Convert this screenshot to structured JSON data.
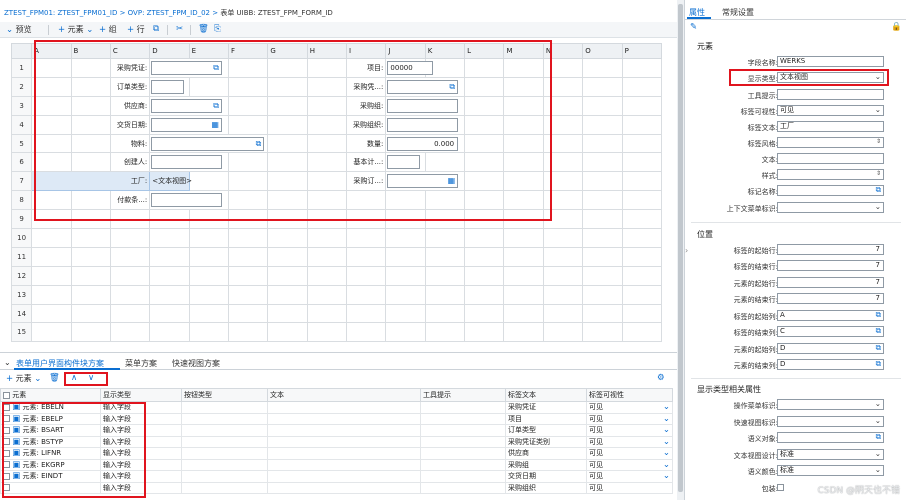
{
  "breadcrumb": {
    "path": "ZTEST_FPM01: ZTEST_FPM01_ID > OVP: ZTEST_FPM_ID_02 > ",
    "current": "表单 UIBB: ZTEST_FPM_FORM_ID"
  },
  "toolbar": {
    "preview": "预览",
    "add_element": "元素",
    "add_group": "组",
    "add_row": "行"
  },
  "grid": {
    "columns": [
      "A",
      "B",
      "C",
      "D",
      "E",
      "F",
      "G",
      "H",
      "I",
      "J",
      "K",
      "L",
      "M",
      "N",
      "O",
      "P"
    ],
    "rows": [
      "1",
      "2",
      "3",
      "4",
      "5",
      "6",
      "7",
      "8",
      "9",
      "10",
      "11",
      "12",
      "13",
      "14",
      "15"
    ],
    "labels": {
      "c1": "采购凭证:",
      "c2": "订单类型:",
      "c3": "供应商:",
      "c4": "交货日期:",
      "c5": "物料:",
      "c6": "创建人:",
      "c7": "工厂:",
      "c8": "付款条...:",
      "i1": "项目:",
      "i2": "采购凭...:",
      "i3": "采购组:",
      "i4": "采购组织:",
      "i5": "数量:",
      "i6": "基本计...:",
      "i7": "采购订...:"
    },
    "values": {
      "item": "00000",
      "quantity": "0.000",
      "plant_view": "<文本视图>"
    }
  },
  "bottom_tabs": [
    "表单用户界面构件块方案",
    "菜单方案",
    "快速视图方案"
  ],
  "toolbar2": {
    "element": "元素"
  },
  "element_table": {
    "headers": [
      "元素",
      "显示类型",
      "按钮类型",
      "文本",
      "工具提示",
      "标签文本",
      "标签可视性"
    ],
    "rows": [
      {
        "element": "元素: EBELN",
        "type": "输入字段",
        "label": "采购凭证",
        "visibility": "可见"
      },
      {
        "element": "元素: EBELP",
        "type": "输入字段",
        "label": "项目",
        "visibility": "可见"
      },
      {
        "element": "元素: BSART",
        "type": "输入字段",
        "label": "订单类型",
        "visibility": "可见"
      },
      {
        "element": "元素: BSTYP",
        "type": "输入字段",
        "label": "采购凭证类别",
        "visibility": "可见"
      },
      {
        "element": "元素: LIFNR",
        "type": "输入字段",
        "label": "供应商",
        "visibility": "可见"
      },
      {
        "element": "元素: EKGRP",
        "type": "输入字段",
        "label": "采购组",
        "visibility": "可见"
      },
      {
        "element": "元素: EINDT",
        "type": "输入字段",
        "label": "交货日期",
        "visibility": "可见"
      }
    ],
    "cut_row": {
      "type": "输入字段",
      "label": "采购组织",
      "visibility": "可见"
    }
  },
  "right_tabs": [
    "属性",
    "常规设置"
  ],
  "props": {
    "element_section": "元素",
    "field_name_label": "字段名称:",
    "field_name": "WERKS",
    "display_type_label": "显示类型:",
    "display_type": "文本视图",
    "tooltip_label": "工具提示:",
    "label_visibility_label": "标签可视性:",
    "label_visibility": "可见",
    "label_text_label": "标签文本:",
    "label_text": "工厂",
    "label_style_label": "标签风格:",
    "text_label": "文本:",
    "style_label": "样式:",
    "marker_name_label": "标记名称:",
    "context_menu_label": "上下文菜单标识:",
    "position_section": "位置",
    "label_start_row_label": "标签的起始行:",
    "label_start_row": "7",
    "label_end_row_label": "标签的结束行:",
    "label_end_row": "7",
    "elem_start_row_label": "元素的起始行:",
    "elem_start_row": "7",
    "elem_end_row_label": "元素的结束行:",
    "elem_end_row": "7",
    "label_start_col_label": "标签的起始列:",
    "label_start_col": "A",
    "label_end_col_label": "标签的结束列:",
    "label_end_col": "C",
    "elem_start_col_label": "元素的起始列:",
    "elem_start_col": "D",
    "elem_end_col_label": "元素的结束列:",
    "elem_end_col": "D",
    "display_section": "显示类型相关属性",
    "action_menu_label": "操作菜单标识:",
    "quickview_label": "快速视图标识:",
    "semantic_label": "语义对象:",
    "text_view_design_label": "文本视图设计:",
    "text_view_design": "标准",
    "semantic_color_label": "语义颜色:",
    "semantic_color": "标准",
    "wrap_label": "包装:"
  },
  "watermark": "CSDN @阴天也不错"
}
